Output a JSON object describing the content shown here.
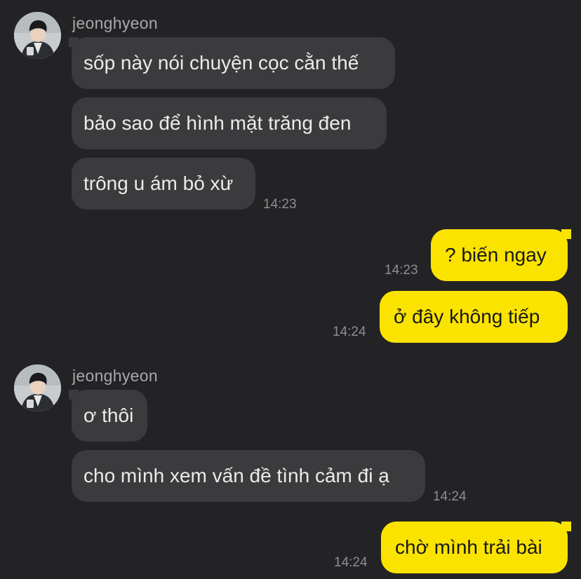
{
  "colors": {
    "background": "#232325",
    "incoming_bubble": "#3b3b3d",
    "outgoing_bubble": "#fbe300",
    "incoming_text": "#ebebeb",
    "outgoing_text": "#191919",
    "timestamp": "#8e8e90",
    "sender_name": "#a8a8aa"
  },
  "groups": [
    {
      "sender": "jeonghyeon",
      "messages": [
        {
          "text": "sốp này nói chuyện cọc cằn thế"
        },
        {
          "text": "bảo sao để hình mặt trăng đen"
        },
        {
          "text": "trông u ám bỏ xừ",
          "time": "14:23"
        }
      ]
    },
    {
      "sender": "me",
      "messages": [
        {
          "text": "? biến ngay",
          "time": "14:23"
        },
        {
          "text": "ở đây không tiếp",
          "time": "14:24"
        }
      ]
    },
    {
      "sender": "jeonghyeon",
      "messages": [
        {
          "text": "ơ thôi"
        },
        {
          "text": "cho mình xem vấn đề tình cảm đi ạ",
          "time": "14:24"
        }
      ]
    },
    {
      "sender": "me",
      "messages": [
        {
          "text": "chờ mình trải bài",
          "time": "14:24"
        }
      ]
    }
  ]
}
